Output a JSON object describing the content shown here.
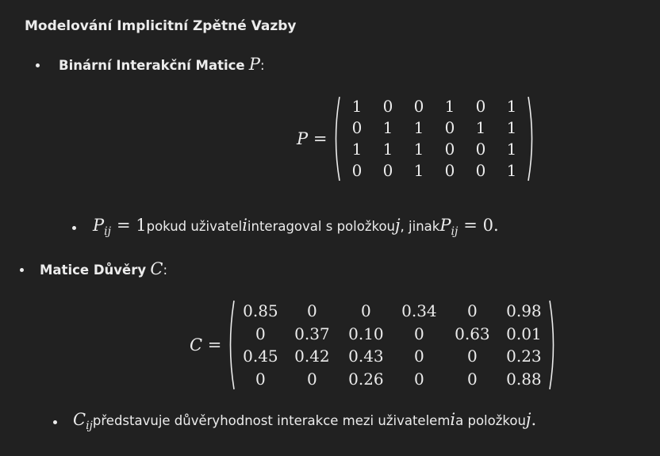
{
  "heading": "Modelování Implicitní Zpětné Vazby",
  "section1": {
    "label": "Binární Interakční Matice",
    "symbol": "P",
    "colon": ":",
    "equation_symbol": "P",
    "equals": "=",
    "matrix": [
      [
        "1",
        "0",
        "0",
        "1",
        "0",
        "1"
      ],
      [
        "0",
        "1",
        "1",
        "0",
        "1",
        "1"
      ],
      [
        "1",
        "1",
        "1",
        "0",
        "0",
        "1"
      ],
      [
        "0",
        "0",
        "1",
        "0",
        "0",
        "1"
      ]
    ],
    "note": {
      "sym1": "P",
      "sub1": "ij",
      "eq1": "= 1",
      "text1": " pokud uživatel ",
      "var_i": "i",
      "text2": " interagoval s položkou ",
      "var_j": "j",
      "text3": ", jinak ",
      "sym2": "P",
      "sub2": "ij",
      "eq2": "= 0",
      "end": "."
    }
  },
  "section2": {
    "label": "Matice Důvěry",
    "symbol": "C",
    "colon": ":",
    "equation_symbol": "C",
    "equals": "=",
    "matrix": [
      [
        "0.85",
        "0",
        "0",
        "0.34",
        "0",
        "0.98"
      ],
      [
        "0",
        "0.37",
        "0.10",
        "0",
        "0.63",
        "0.01"
      ],
      [
        "0.45",
        "0.42",
        "0.43",
        "0",
        "0",
        "0.23"
      ],
      [
        "0",
        "0",
        "0.26",
        "0",
        "0",
        "0.88"
      ]
    ],
    "note": {
      "sym": "C",
      "sub": "ij",
      "text1": " představuje důvěryhodnost interakce mezi uživatelem ",
      "var_i": "i",
      "text2": " a položkou ",
      "var_j": "j",
      "end": "."
    }
  }
}
